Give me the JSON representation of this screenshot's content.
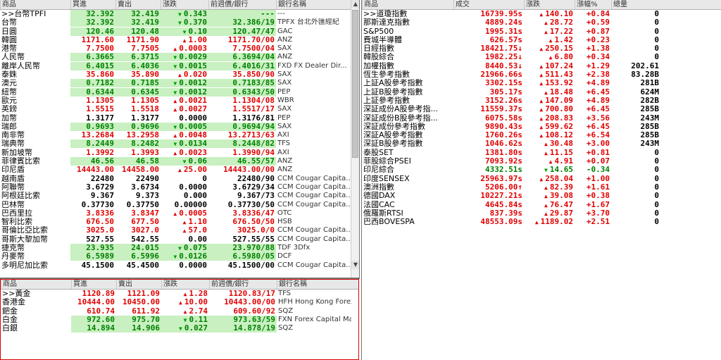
{
  "fx": {
    "headers": [
      "商品",
      "買進",
      "賣出",
      "漲跌",
      "前週價/銀行",
      "銀行名稱"
    ],
    "rows": [
      {
        "name": ">>台幣TPFI",
        "bid": "32.392",
        "ask": "32.419",
        "chg": "0.343",
        "dir": "down",
        "prev": "---",
        "bank": "---",
        "hl": true
      },
      {
        "name": "台幣",
        "bid": "32.392",
        "ask": "32.419",
        "chg": "0.370",
        "dir": "down",
        "prev": "32.386/19",
        "bank": "TPFX 台北外匯經紀",
        "hl": true
      },
      {
        "name": "日圓",
        "bid": "120.46",
        "ask": "120.48",
        "chg": "0.10",
        "dir": "down",
        "prev": "120.47/47",
        "bank": "GAC",
        "hl": true
      },
      {
        "name": "韓圓",
        "bid": "1171.60",
        "ask": "1171.90",
        "chg": "1.00",
        "dir": "up",
        "prev": "1171.70/00",
        "bank": "ANZ",
        "hl": false
      },
      {
        "name": "港幣",
        "bid": "7.7500",
        "ask": "7.7505",
        "chg": "0.0003",
        "dir": "up",
        "prev": "7.7500/04",
        "bank": "SAX",
        "hl": false
      },
      {
        "name": "人民幣",
        "bid": "6.3665",
        "ask": "6.3715",
        "chg": "0.0029",
        "dir": "down",
        "prev": "6.3694/04",
        "bank": "ANZ",
        "hl": true
      },
      {
        "name": "離岸人民幣",
        "bid": "6.4015",
        "ask": "6.4036",
        "chg": "0.0015",
        "dir": "down",
        "prev": "6.4016/31",
        "bank": "FXD FX Dealer Dir...",
        "hl": true
      },
      {
        "name": "泰銖",
        "bid": "35.860",
        "ask": "35.890",
        "chg": "0.020",
        "dir": "up",
        "prev": "35.850/90",
        "bank": "SAX",
        "hl": false
      },
      {
        "name": "澳元",
        "bid": "0.7182",
        "ask": "0.7185",
        "chg": "0.0012",
        "dir": "down",
        "prev": "0.7183/85",
        "bank": "SAX",
        "hl": true
      },
      {
        "name": "紐幣",
        "bid": "0.6344",
        "ask": "0.6345",
        "chg": "0.0012",
        "dir": "down",
        "prev": "0.6343/50",
        "bank": "PEP",
        "hl": true
      },
      {
        "name": "歐元",
        "bid": "1.1305",
        "ask": "1.1305",
        "chg": "0.0021",
        "dir": "up",
        "prev": "1.1304/08",
        "bank": "WBR",
        "hl": false
      },
      {
        "name": "英鎊",
        "bid": "1.5515",
        "ask": "1.5518",
        "chg": "0.0027",
        "dir": "up",
        "prev": "1.5517/17",
        "bank": "SAX",
        "hl": false
      },
      {
        "name": "加幣",
        "bid": "1.3177",
        "ask": "1.3177",
        "chg": "0.0000",
        "dir": "none",
        "prev": "1.3176/81",
        "bank": "PEP",
        "hl": false
      },
      {
        "name": "瑞郎",
        "bid": "0.9693",
        "ask": "0.9696",
        "chg": "0.0005",
        "dir": "down",
        "prev": "0.9694/94",
        "bank": "SAX",
        "hl": true
      },
      {
        "name": "南非幣",
        "bid": "13.2684",
        "ask": "13.2958",
        "chg": "0.0048",
        "dir": "up",
        "prev": "13.2713/63",
        "bank": "AXI",
        "hl": false
      },
      {
        "name": "瑞典幣",
        "bid": "8.2449",
        "ask": "8.2482",
        "chg": "0.0134",
        "dir": "down",
        "prev": "8.2448/82",
        "bank": "TFS",
        "hl": true
      },
      {
        "name": "新加坡幣",
        "bid": "1.3992",
        "ask": "1.3993",
        "chg": "0.0023",
        "dir": "up",
        "prev": "1.3990/94",
        "bank": "AXI",
        "hl": false
      },
      {
        "name": "菲律賓比索",
        "bid": "46.56",
        "ask": "46.58",
        "chg": "0.06",
        "dir": "down",
        "prev": "46.55/57",
        "bank": "ANZ",
        "hl": true
      },
      {
        "name": "印尼盾",
        "bid": "14443.00",
        "ask": "14458.00",
        "chg": "25.00",
        "dir": "up",
        "prev": "14443.00/00",
        "bank": "ANZ",
        "hl": false
      },
      {
        "name": "越南盾",
        "bid": "22480",
        "ask": "22490",
        "chg": "0",
        "dir": "none",
        "prev": "22480/90",
        "bank": "CCM Cougar Capita...",
        "hl": false
      },
      {
        "name": "阿聯幣",
        "bid": "3.6729",
        "ask": "3.6734",
        "chg": "0.0000",
        "dir": "none",
        "prev": "3.6729/34",
        "bank": "CCM Cougar Capita...",
        "hl": false
      },
      {
        "name": "阿根廷比索",
        "bid": "9.367",
        "ask": "9.373",
        "chg": "0.000",
        "dir": "none",
        "prev": "9.367/73",
        "bank": "CCM Cougar Capita...",
        "hl": false
      },
      {
        "name": "巴林幣",
        "bid": "0.37730",
        "ask": "0.37750",
        "chg": "0.00000",
        "dir": "none",
        "prev": "0.37730/50",
        "bank": "CCM Cougar Capita...",
        "hl": false
      },
      {
        "name": "巴西里拉",
        "bid": "3.8336",
        "ask": "3.8347",
        "chg": "0.0005",
        "dir": "up",
        "prev": "3.8336/47",
        "bank": "OTC",
        "hl": false
      },
      {
        "name": "智利比索",
        "bid": "676.50",
        "ask": "677.50",
        "chg": "1.10",
        "dir": "up",
        "prev": "676.50/50",
        "bank": "HSB",
        "hl": false
      },
      {
        "name": "哥倫比亞比索",
        "bid": "3025.0",
        "ask": "3027.0",
        "chg": "57.0",
        "dir": "up",
        "prev": "3025.0/0",
        "bank": "CCM Cougar Capita...",
        "hl": false
      },
      {
        "name": "哥斯大黎加幣",
        "bid": "527.55",
        "ask": "542.55",
        "chg": "0.00",
        "dir": "none",
        "prev": "527.55/55",
        "bank": "CCM Cougar Capita...",
        "hl": false
      },
      {
        "name": "捷克幣",
        "bid": "23.935",
        "ask": "24.015",
        "chg": "0.075",
        "dir": "down",
        "prev": "23.970/88",
        "bank": "TDF 3Dfx",
        "hl": true
      },
      {
        "name": "丹麥幣",
        "bid": "6.5989",
        "ask": "6.5996",
        "chg": "0.0126",
        "dir": "down",
        "prev": "6.5980/05",
        "bank": "DCF",
        "hl": true
      },
      {
        "name": "多明尼加比索",
        "bid": "45.1500",
        "ask": "45.4500",
        "chg": "0.0000",
        "dir": "none",
        "prev": "45.1500/00",
        "bank": "CCM Cougar Capita...",
        "hl": false
      }
    ]
  },
  "metals": {
    "headers": [
      "商品",
      "買進",
      "賣出",
      "漲跌",
      "前週價/銀行",
      "銀行名稱"
    ],
    "rows": [
      {
        "name": ">>黃金",
        "bid": "1120.89",
        "ask": "1121.09",
        "chg": "1.28",
        "dir": "up",
        "prev": "1120.83/17",
        "bank": "TFS",
        "hl": false
      },
      {
        "name": "香港金",
        "bid": "10444.00",
        "ask": "10450.00",
        "chg": "10.00",
        "dir": "up",
        "prev": "10443.00/00",
        "bank": "HFH Hong Kong Forex Investm...",
        "hl": false
      },
      {
        "name": "鈀金",
        "bid": "610.74",
        "ask": "611.92",
        "chg": "2.74",
        "dir": "up",
        "prev": "609.60/92",
        "bank": "SQZ",
        "hl": false
      },
      {
        "name": "白金",
        "bid": "972.60",
        "ask": "975.70",
        "chg": "0.11",
        "dir": "down",
        "prev": "973.63/59",
        "bank": "FXN Forex Capital Markets",
        "hl": true
      },
      {
        "name": "白銀",
        "bid": "14.894",
        "ask": "14.906",
        "chg": "0.027",
        "dir": "down",
        "prev": "14.878/19",
        "bank": "SQZ",
        "hl": true
      }
    ]
  },
  "indices": {
    "headers": [
      "商品",
      "成交",
      "漲跌",
      "漲幅%",
      "總量"
    ],
    "rows": [
      {
        "name": ">>道瓊指數",
        "last": "16739.95s",
        "chg": "140.10",
        "pct": "+0.84",
        "vol": "0",
        "dir": "up",
        "color": "red"
      },
      {
        "name": "那斯達克指數",
        "last": "4889.24s",
        "chg": "28.72",
        "pct": "+0.59",
        "vol": "0",
        "dir": "up",
        "color": "red"
      },
      {
        "name": "S&P500",
        "last": "1995.31s",
        "chg": "17.22",
        "pct": "+0.87",
        "vol": "0",
        "dir": "up",
        "color": "red"
      },
      {
        "name": "費城半導體",
        "last": "626.57s",
        "chg": "1.42",
        "pct": "+0.23",
        "vol": "0",
        "dir": "up",
        "color": "red"
      },
      {
        "name": "日經指數",
        "last": "18421.75↓",
        "chg": "250.15",
        "pct": "+1.38",
        "vol": "0",
        "dir": "up",
        "color": "red"
      },
      {
        "name": "韓股綜合",
        "last": "1982.25↓",
        "chg": "6.80",
        "pct": "+0.34",
        "vol": "0",
        "dir": "up",
        "color": "red"
      },
      {
        "name": "加權指數",
        "last": "8440.53↓",
        "chg": "107.24",
        "pct": "+1.29",
        "vol": "202.61",
        "dir": "up",
        "color": "red"
      },
      {
        "name": "恆生參考指數",
        "last": "21966.66s",
        "chg": "511.43",
        "pct": "+2.38",
        "vol": "83.28B",
        "dir": "up",
        "color": "red"
      },
      {
        "name": "上証A股參考指數",
        "last": "3302.15s",
        "chg": "153.92",
        "pct": "+4.89",
        "vol": "281B",
        "dir": "up",
        "color": "red"
      },
      {
        "name": "上証B股參考指數",
        "last": "305.17s",
        "chg": "18.48",
        "pct": "+6.45",
        "vol": "624M",
        "dir": "up",
        "color": "red"
      },
      {
        "name": "上証參考指數",
        "last": "3152.26s",
        "chg": "147.09",
        "pct": "+4.89",
        "vol": "282B",
        "dir": "up",
        "color": "red"
      },
      {
        "name": "深証成份A股參考指...",
        "last": "11559.37s",
        "chg": "700.80",
        "pct": "+6.45",
        "vol": "285B",
        "dir": "up",
        "color": "red"
      },
      {
        "name": "深証成份B股參考指...",
        "last": "6075.58s",
        "chg": "208.83",
        "pct": "+3.56",
        "vol": "243M",
        "dir": "up",
        "color": "red"
      },
      {
        "name": "深証成份參考指數",
        "last": "9890.43s",
        "chg": "599.62",
        "pct": "+6.45",
        "vol": "285B",
        "dir": "up",
        "color": "red"
      },
      {
        "name": "深証A股參考指數",
        "last": "1760.26s",
        "chg": "108.12",
        "pct": "+6.54",
        "vol": "285B",
        "dir": "up",
        "color": "red"
      },
      {
        "name": "深証B股參考指數",
        "last": "1046.62s",
        "chg": "30.48",
        "pct": "+3.00",
        "vol": "243M",
        "dir": "up",
        "color": "red"
      },
      {
        "name": "泰股SET",
        "last": "1381.80s",
        "chg": "11.15",
        "pct": "+0.81",
        "vol": "0",
        "dir": "up",
        "color": "red"
      },
      {
        "name": "菲股綜合PSEI",
        "last": "7093.92s",
        "chg": "4.91",
        "pct": "+0.07",
        "vol": "0",
        "dir": "up",
        "color": "red"
      },
      {
        "name": "印尼綜合",
        "last": "4332.51s",
        "chg": "14.65",
        "pct": "-0.34",
        "vol": "0",
        "dir": "down",
        "color": "green"
      },
      {
        "name": "印度SENSEX",
        "last": "25963.97s",
        "chg": "258.04",
        "pct": "+1.00",
        "vol": "0",
        "dir": "up",
        "color": "red"
      },
      {
        "name": "澳洲指數",
        "last": "5206.00↑",
        "chg": "82.39",
        "pct": "+1.61",
        "vol": "0",
        "dir": "up",
        "color": "red"
      },
      {
        "name": "德國DAX",
        "last": "10227.21s",
        "chg": "39.08",
        "pct": "+0.38",
        "vol": "0",
        "dir": "up",
        "color": "red"
      },
      {
        "name": "法國CAC",
        "last": "4645.84s",
        "chg": "76.47",
        "pct": "+1.67",
        "vol": "0",
        "dir": "up",
        "color": "red"
      },
      {
        "name": "俄羅斯RTSI",
        "last": "837.39s",
        "chg": "29.87",
        "pct": "+3.70",
        "vol": "0",
        "dir": "up",
        "color": "red"
      },
      {
        "name": "巴西BOVESPA",
        "last": "48553.09s",
        "chg": "1189.02",
        "pct": "+2.51",
        "vol": "0",
        "dir": "up",
        "color": "red"
      }
    ]
  },
  "icons": {
    "scroll_up": "scroll-up-arrow-icon",
    "scroll_down": "scroll-down-arrow-icon",
    "up": "triangle-up-icon",
    "down": "triangle-down-icon"
  },
  "colors": {
    "up": "#e00000",
    "down": "#008000",
    "highlight": "#c8f0c0"
  }
}
